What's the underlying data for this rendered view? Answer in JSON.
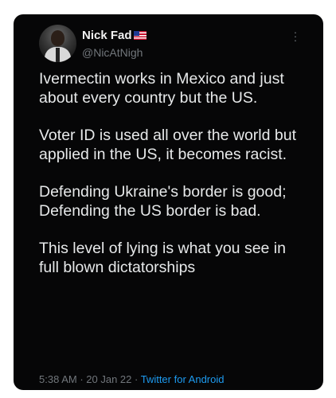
{
  "tweet": {
    "display_name": "Nick Fad",
    "handle": "@NicAtNigh",
    "more_icon": "more-vertical-icon",
    "paragraphs": [
      "Ivermectin works in Mexico and just about every country but the US.",
      "Voter ID is used all over the world but applied in the US, it becomes racist.",
      "Defending Ukraine's border is good; Defending the US border is bad.",
      "This level of lying is what you see in full blown dictatorships"
    ],
    "time": "5:38 AM",
    "date": "20 Jan 22",
    "separator": " · ",
    "source": "Twitter for Android"
  },
  "colors": {
    "card_background": "#060607",
    "text": "#e7e9ea",
    "secondary_text": "#71767b",
    "link": "#1d9bf0"
  }
}
